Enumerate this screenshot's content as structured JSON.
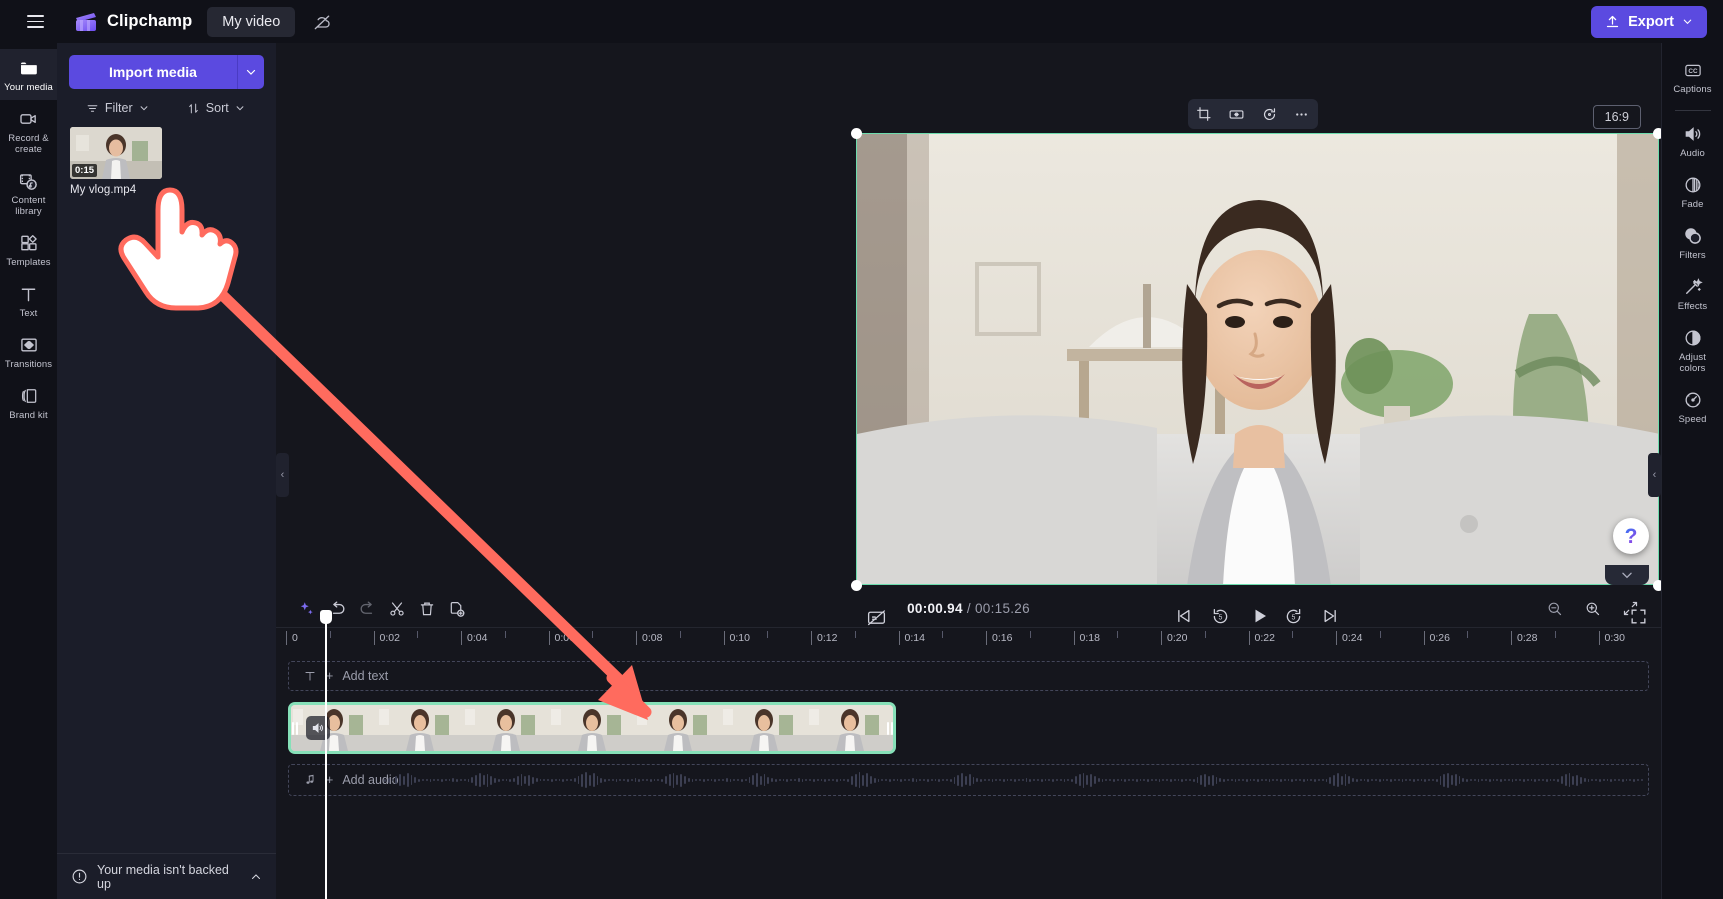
{
  "app": {
    "brand": "Clipchamp",
    "project_title": "My video",
    "menu_icon": "hamburger-icon",
    "cloud_icon": "cloud-off-icon"
  },
  "topbar": {
    "export_label": "Export",
    "export_icon": "upload-icon",
    "export_caret": "chevron-down-icon",
    "accent_color": "#5b4ae0"
  },
  "left_rail": {
    "items": [
      {
        "label": "Your media",
        "icon": "folder-icon",
        "active": true
      },
      {
        "label": "Record &\ncreate",
        "icon": "video-camera-icon",
        "active": false
      },
      {
        "label": "Content\nlibrary",
        "icon": "content-library-icon",
        "active": false
      },
      {
        "label": "Templates",
        "icon": "templates-icon",
        "active": false
      },
      {
        "label": "Text",
        "icon": "text-icon",
        "active": false
      },
      {
        "label": "Transitions",
        "icon": "transitions-icon",
        "active": false
      },
      {
        "label": "Brand kit",
        "icon": "brand-kit-icon",
        "active": false
      }
    ]
  },
  "media_panel": {
    "import_label": "Import media",
    "import_caret_icon": "chevron-down-icon",
    "filter_label": "Filter",
    "filter_icon": "filter-icon",
    "filter_caret": "chevron-down-icon",
    "sort_label": "Sort",
    "sort_icon": "sort-arrows-icon",
    "sort_caret": "chevron-down-icon",
    "media_items": [
      {
        "name": "My vlog.mp4",
        "duration": "0:15"
      }
    ],
    "backup_notice": "Your media isn't backed up",
    "backup_icon": "alert-circle-icon",
    "backup_caret": "chevron-up-icon"
  },
  "preview": {
    "float_tools": [
      {
        "icon": "crop-icon",
        "name": "crop"
      },
      {
        "icon": "fit-width-icon",
        "name": "fit"
      },
      {
        "icon": "rotate-icon",
        "name": "rotate"
      },
      {
        "icon": "more-horizontal-icon",
        "name": "more"
      }
    ],
    "aspect_ratio": "16:9",
    "selection_color": "#6ddcae",
    "controls": [
      {
        "icon": "captions-off-icon",
        "name": "toggle-captions"
      },
      {
        "icon": "skip-back-icon",
        "name": "jump-to-start"
      },
      {
        "icon": "rewind-5-icon",
        "name": "back-5-seconds"
      },
      {
        "icon": "play-icon",
        "name": "play"
      },
      {
        "icon": "forward-5-icon",
        "name": "forward-5-seconds"
      },
      {
        "icon": "skip-forward-icon",
        "name": "jump-to-end"
      },
      {
        "icon": "fullscreen-icon",
        "name": "fullscreen"
      }
    ]
  },
  "right_rail": {
    "items": [
      {
        "label": "Captions",
        "icon": "cc-icon"
      },
      {
        "label": "Audio",
        "icon": "speaker-icon"
      },
      {
        "label": "Fade",
        "icon": "fade-icon"
      },
      {
        "label": "Filters",
        "icon": "filters-icon"
      },
      {
        "label": "Effects",
        "icon": "effects-wand-icon"
      },
      {
        "label": "Adjust\ncolors",
        "icon": "adjust-colors-icon"
      },
      {
        "label": "Speed",
        "icon": "speed-gauge-icon"
      }
    ]
  },
  "help": {
    "icon": "question-mark-icon",
    "caret_icon": "chevron-down-icon"
  },
  "timeline": {
    "tools": [
      {
        "icon": "ai-sparkle-icon",
        "name": "auto-compose"
      },
      {
        "icon": "undo-icon",
        "name": "undo"
      },
      {
        "icon": "redo-icon",
        "name": "redo"
      },
      {
        "icon": "scissors-icon",
        "name": "split"
      },
      {
        "icon": "trash-icon",
        "name": "delete"
      },
      {
        "icon": "duplicate-icon",
        "name": "duplicate"
      }
    ],
    "current_time": "00:00.94",
    "total_time": "00:15.26",
    "time_separator": "/",
    "zoom_tools": [
      {
        "icon": "zoom-out-icon",
        "name": "zoom-out"
      },
      {
        "icon": "zoom-in-icon",
        "name": "zoom-in"
      },
      {
        "icon": "fit-timeline-icon",
        "name": "fit-to-timeline"
      }
    ],
    "ruler_ticks": [
      "0",
      "0:02",
      "0:04",
      "0:06",
      "0:08",
      "0:10",
      "0:12",
      "0:14",
      "0:16",
      "0:18",
      "0:20",
      "0:22",
      "0:24",
      "0:26",
      "0:28",
      "0:30"
    ],
    "text_track": {
      "label": "Add text",
      "icon": "text-t-icon",
      "plus": "+"
    },
    "audio_track": {
      "label": "Add audio",
      "icon": "music-note-icon",
      "plus": "+"
    },
    "video_clip": {
      "color": "#86e0b8",
      "audio_icon": "speaker-icon",
      "left_handle": "trim-handle",
      "right_handle": "trim-handle"
    },
    "playhead_position_label": "00:00.94"
  },
  "annotation": {
    "arrow_color": "#ff6b5e",
    "hand_cursor": "pointing-hand-cursor"
  }
}
